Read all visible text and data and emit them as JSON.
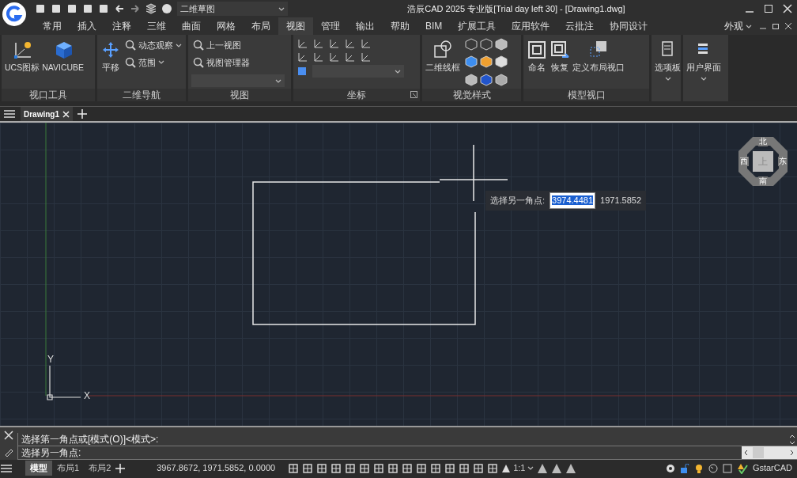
{
  "title_bar": {
    "workspace": "二维草图",
    "title": "浩辰CAD 2025 专业版[Trial day left 30] - [Drawing1.dwg]"
  },
  "ribbon_tabs": [
    {
      "label": "常用",
      "selected": false
    },
    {
      "label": "插入",
      "selected": false
    },
    {
      "label": "注释",
      "selected": false
    },
    {
      "label": "三维",
      "selected": false
    },
    {
      "label": "曲面",
      "selected": false
    },
    {
      "label": "网格",
      "selected": false
    },
    {
      "label": "布局",
      "selected": false
    },
    {
      "label": "视图",
      "selected": true
    },
    {
      "label": "管理",
      "selected": false
    },
    {
      "label": "输出",
      "selected": false
    },
    {
      "label": "帮助",
      "selected": false
    },
    {
      "label": "BIM",
      "selected": false
    },
    {
      "label": "扩展工具",
      "selected": false
    },
    {
      "label": "应用软件",
      "selected": false
    },
    {
      "label": "云批注",
      "selected": false
    },
    {
      "label": "协同设计",
      "selected": false
    }
  ],
  "appearance_menu": "外观",
  "panels": [
    {
      "title": "视口工具",
      "tools": [
        {
          "label": "UCS图标",
          "kind": "large"
        },
        {
          "label": "NAVICUBE",
          "kind": "large"
        }
      ]
    },
    {
      "title": "二维导航",
      "tools": [
        {
          "label": "平移",
          "kind": "large"
        },
        {
          "label": "动态观察",
          "kind": "small"
        },
        {
          "label": "范围",
          "kind": "small"
        }
      ]
    },
    {
      "title": "视图",
      "tools": [
        {
          "label": "上一视图",
          "kind": "small"
        },
        {
          "label": "视图管理器",
          "kind": "small"
        }
      ]
    },
    {
      "title": "坐标"
    },
    {
      "title": "视觉样式",
      "tools": [
        {
          "label": "二维线框",
          "kind": "large"
        }
      ]
    },
    {
      "title": "模型视口",
      "tools": [
        {
          "label": "命名",
          "kind": "large"
        },
        {
          "label": "恢复",
          "kind": "large"
        },
        {
          "label": "定义布局视口",
          "kind": "large"
        }
      ]
    },
    {
      "tools": [
        {
          "label": "选项板",
          "kind": "large"
        }
      ]
    },
    {
      "tools": [
        {
          "label": "用户界面",
          "kind": "large"
        }
      ]
    }
  ],
  "document_tabs": [
    {
      "label": "Drawing1",
      "selected": true
    }
  ],
  "canvas": {
    "prompt": {
      "label": "选择另一角点:",
      "x_value": "3974.4481",
      "y_value": "1971.5852"
    },
    "compass": {
      "north": "北",
      "south": "南",
      "east": "东",
      "west": "西",
      "face": "上"
    },
    "ucs": {
      "x": "X",
      "y": "Y"
    }
  },
  "command_line": {
    "history": "选择第一角点或[模式(O)]<模式>:",
    "prompt": "选择另一角点:"
  },
  "layout_tabs": [
    {
      "label": "模型",
      "selected": true
    },
    {
      "label": "布局1",
      "selected": false
    },
    {
      "label": "布局2",
      "selected": false
    }
  ],
  "status_bar": {
    "coordinates": "3967.8672, 1971.5852, 0.0000",
    "annotation_scale": "1:1",
    "brand": "GstarCAD"
  }
}
